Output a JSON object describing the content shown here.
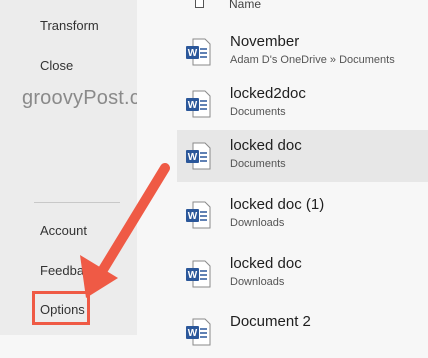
{
  "sidebar": {
    "items": [
      {
        "label": "Transform"
      },
      {
        "label": "Close"
      },
      {
        "label": "Account"
      },
      {
        "label": "Feedback"
      },
      {
        "label": "Options"
      }
    ]
  },
  "watermark": "groovyPost.com",
  "file_list": {
    "header_label": "Name",
    "files": [
      {
        "name": "November",
        "location": "Adam D's OneDrive » Documents"
      },
      {
        "name": "locked2doc",
        "location": "Documents"
      },
      {
        "name": "locked doc",
        "location": "Documents"
      },
      {
        "name": "locked doc (1)",
        "location": "Downloads"
      },
      {
        "name": "locked doc",
        "location": "Downloads"
      },
      {
        "name": "Document 2",
        "location": ""
      }
    ]
  },
  "colors": {
    "accent_red": "#ef5a45",
    "word_blue": "#2b579a"
  }
}
